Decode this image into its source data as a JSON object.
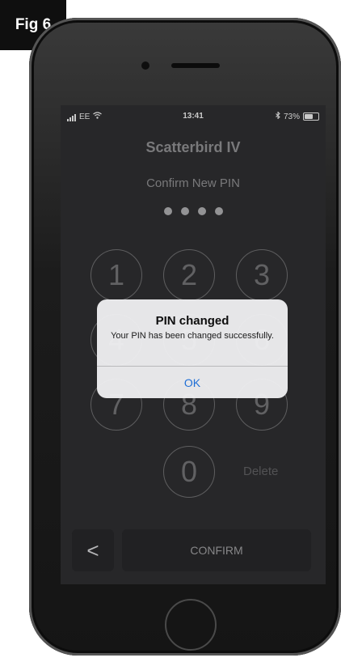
{
  "figure": {
    "label": "Fig 6"
  },
  "status_bar": {
    "carrier": "EE",
    "time": "13:41",
    "battery_percent": "73%",
    "battery_level": 0.73
  },
  "app": {
    "title": "Scatterbird IV",
    "subtitle": "Confirm New PIN",
    "pin_dot_count": 4
  },
  "keypad": {
    "keys": [
      "1",
      "2",
      "3",
      "4",
      "5",
      "6",
      "7",
      "8",
      "9",
      "0"
    ],
    "delete_label": "Delete"
  },
  "bottom_bar": {
    "back_glyph": "<",
    "confirm_label": "CONFIRM"
  },
  "alert": {
    "title": "PIN changed",
    "message": "Your PIN has been changed successfully.",
    "ok_label": "OK",
    "ok_color": "#1f6fd6"
  },
  "icons": [
    "signal-icon",
    "wifi-icon",
    "bluetooth-icon",
    "battery-icon",
    "back-chevron-icon"
  ]
}
